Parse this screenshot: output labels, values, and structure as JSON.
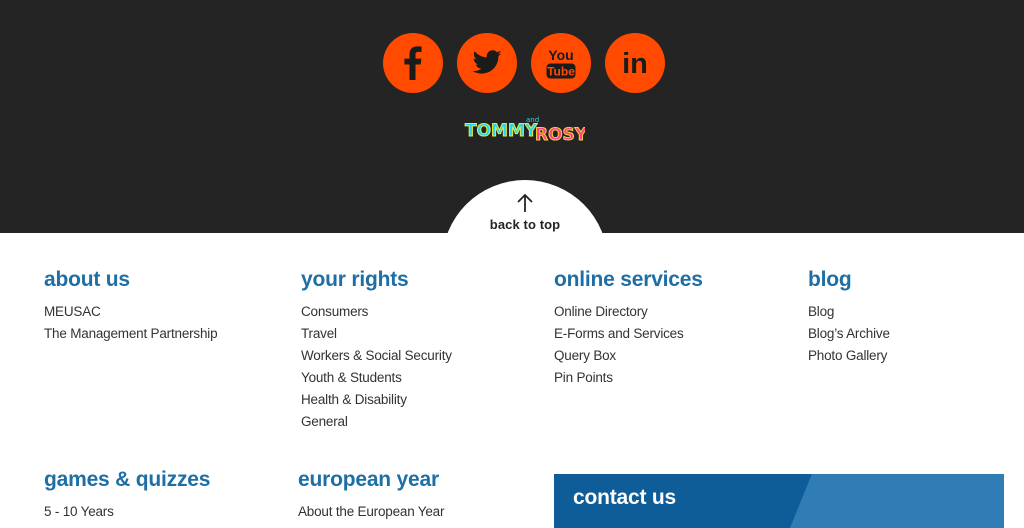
{
  "social": {
    "items": [
      {
        "name": "facebook",
        "icon": "facebook-icon"
      },
      {
        "name": "twitter",
        "icon": "twitter-icon"
      },
      {
        "name": "youtube",
        "icon": "youtube-icon",
        "text_top": "You",
        "text_bottom": "Tube"
      },
      {
        "name": "linkedin",
        "icon": "linkedin-icon",
        "text": "in"
      }
    ],
    "accent_color": "#ff4a00"
  },
  "logo": {
    "word1": "TOMMY",
    "small": "and",
    "word2": "ROSY"
  },
  "back_to_top": {
    "label": "back to top",
    "icon": "arrow-up-icon"
  },
  "columns": {
    "about": {
      "heading": "about us",
      "links": [
        "MEUSAC",
        "The Management Partnership"
      ]
    },
    "rights": {
      "heading": "your rights",
      "links": [
        "Consumers",
        "Travel",
        "Workers & Social Security",
        "Youth & Students",
        "Health & Disability",
        "General"
      ]
    },
    "services": {
      "heading": "online services",
      "links": [
        "Online Directory",
        "E-Forms and Services",
        "Query Box",
        "Pin Points"
      ]
    },
    "blog": {
      "heading": "blog",
      "links": [
        "Blog",
        "Blog’s Archive",
        "Photo Gallery"
      ]
    },
    "games": {
      "heading": "games & quizzes",
      "links": [
        "5 - 10 Years"
      ]
    },
    "european": {
      "heading": "european year",
      "links": [
        "About the European Year"
      ]
    }
  },
  "contact": {
    "heading": "contact us"
  },
  "colors": {
    "dark_band": "#242424",
    "heading_blue": "#1d6fa5",
    "contact_blue": "#0e5d98"
  }
}
